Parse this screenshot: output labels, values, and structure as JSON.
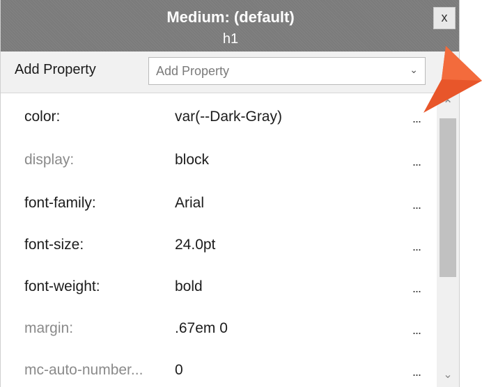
{
  "window": {
    "title": "Medium: (default)",
    "subtitle": "h1",
    "close_label": "x"
  },
  "add_property": {
    "label": "Add Property",
    "placeholder": "Add Property"
  },
  "properties": [
    {
      "name": "color:",
      "value": "var(--Dark-Gray)",
      "state": "set"
    },
    {
      "name": "display:",
      "value": "block",
      "state": "inherited"
    },
    {
      "name": "font-family:",
      "value": "Arial",
      "state": "set"
    },
    {
      "name": "font-size:",
      "value": "24.0pt",
      "state": "set"
    },
    {
      "name": "font-weight:",
      "value": "bold",
      "state": "set"
    },
    {
      "name": "margin:",
      "value": ".67em 0",
      "state": "inherited"
    },
    {
      "name": "mc-auto-number...",
      "value": "0",
      "state": "inherited"
    }
  ],
  "more_label": "...",
  "icons": {
    "dropdown": "chevron-down-icon",
    "close": "close-icon",
    "scroll_up": "scroll-up-icon",
    "scroll_down": "scroll-down-icon",
    "callout": "pointer-arrow-icon"
  },
  "colors": {
    "titlebar": "#7b7b7b",
    "callout_arrow": "#e8562a",
    "inherited_text": "#8a8a8a"
  }
}
